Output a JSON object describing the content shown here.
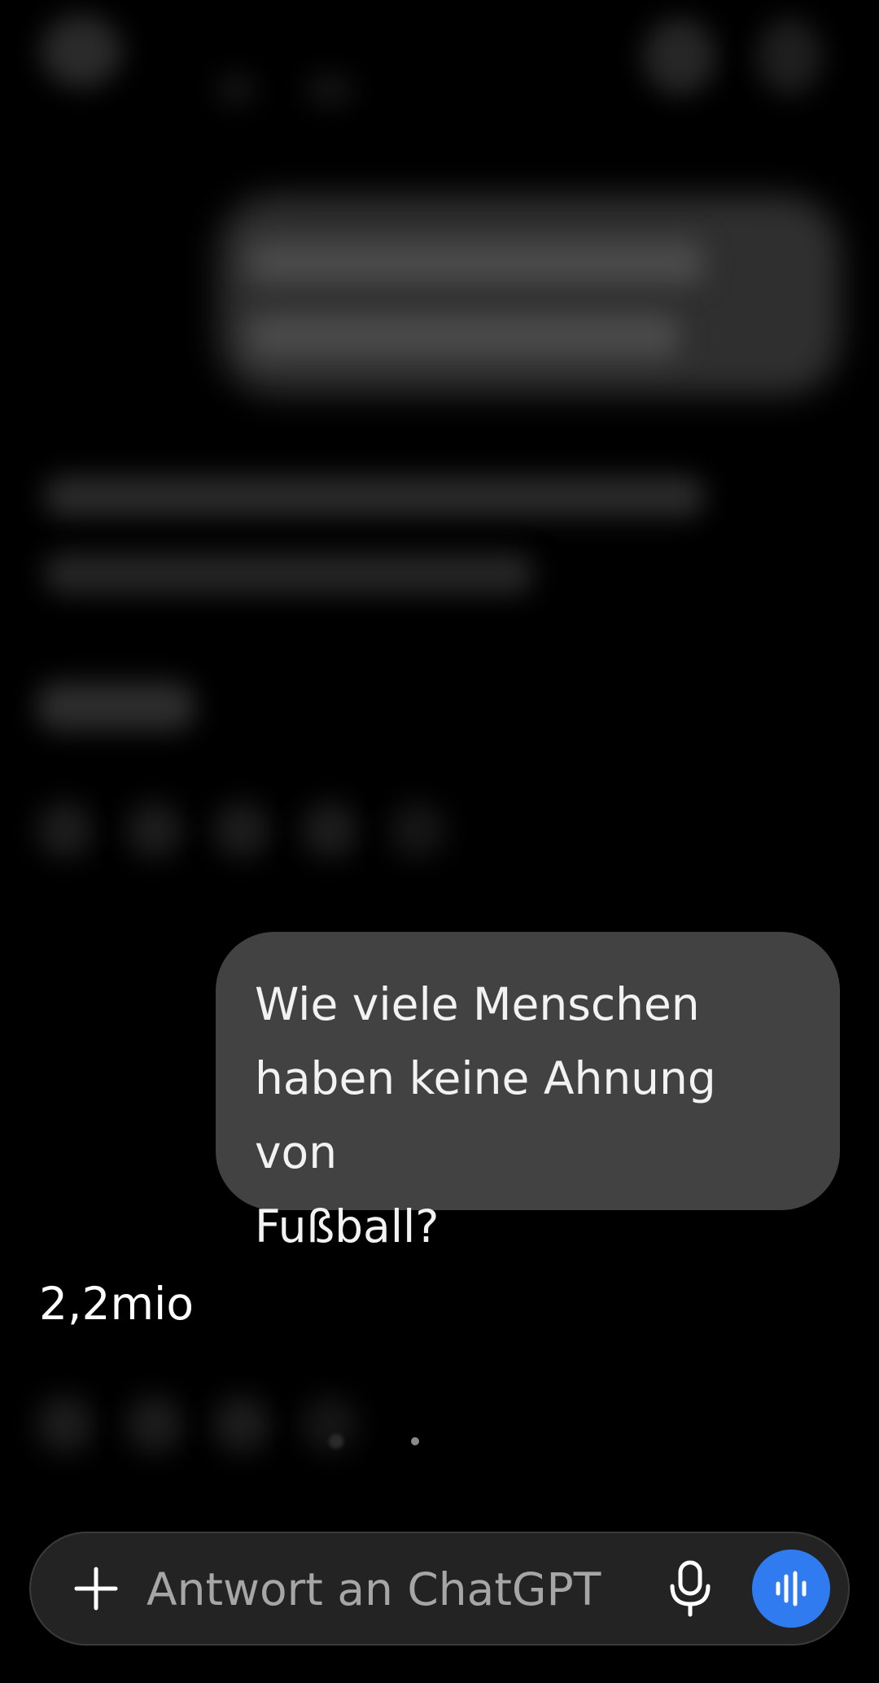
{
  "conversation": {
    "user_message": {
      "line1": "Wie viele Menschen",
      "line2": "haben keine Ahnung von",
      "line3": "Fußball?"
    },
    "assistant_reply": "2,2mio"
  },
  "composer": {
    "placeholder": "Antwort an ChatGPT",
    "voice_button_color": "#2f7bef"
  },
  "icons": {
    "add": "plus-icon",
    "mic": "microphone-icon",
    "voice": "voice-waveform-icon"
  }
}
